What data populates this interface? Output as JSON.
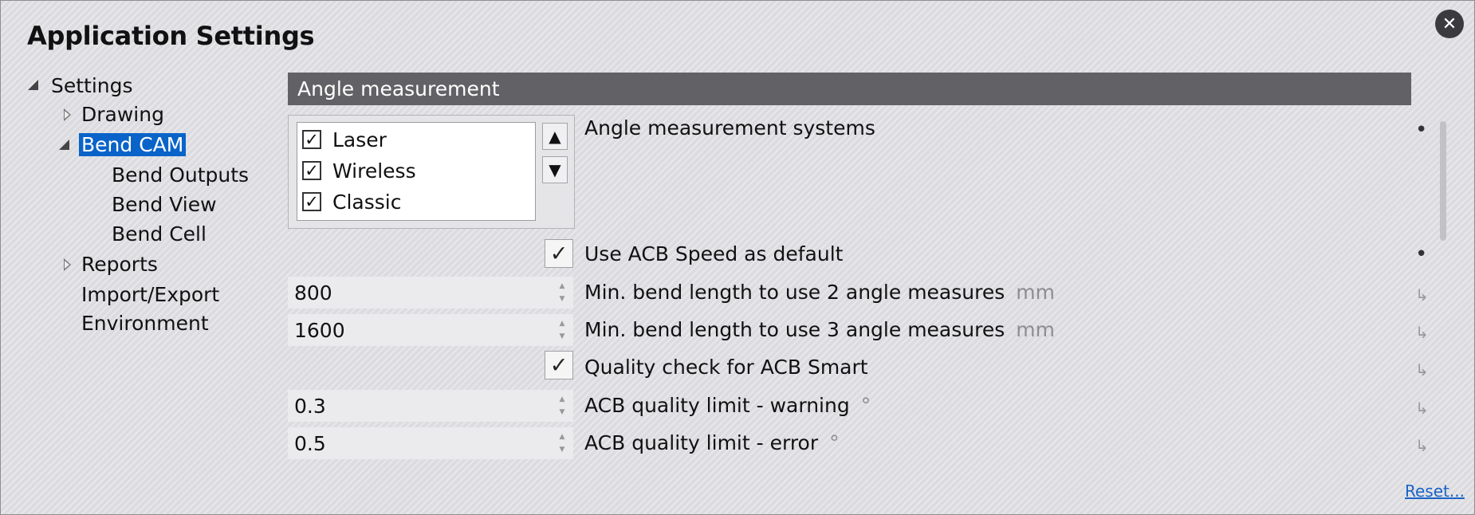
{
  "window": {
    "title": "Application Settings"
  },
  "tree": {
    "root": "Settings",
    "drawing": "Drawing",
    "bend_cam": "Bend CAM",
    "bend_outputs": "Bend Outputs",
    "bend_view": "Bend View",
    "bend_cell": "Bend Cell",
    "reports": "Reports",
    "import_export": "Import/Export",
    "environment": "Environment"
  },
  "section": {
    "header": "Angle measurement"
  },
  "angle_systems": {
    "items": [
      {
        "label": "Laser",
        "checked": true
      },
      {
        "label": "Wireless",
        "checked": true
      },
      {
        "label": "Classic",
        "checked": true
      }
    ],
    "label": "Angle measurement systems"
  },
  "settings": {
    "use_acb_speed": {
      "label": "Use ACB Speed as default",
      "checked": true
    },
    "min_bend_2": {
      "value": "800",
      "label": "Min. bend length to use 2 angle measures",
      "unit": "mm"
    },
    "min_bend_3": {
      "value": "1600",
      "label": "Min. bend length to use 3 angle measures",
      "unit": "mm"
    },
    "quality_check": {
      "label": "Quality check for ACB Smart",
      "checked": true
    },
    "quality_warning": {
      "value": "0.3",
      "label": "ACB quality limit - warning",
      "unit": "°"
    },
    "quality_error": {
      "value": "0.5",
      "label": "ACB quality limit - error",
      "unit": "°"
    }
  },
  "markers": {
    "modified": "•",
    "inherited": "↳"
  },
  "icons": {
    "close": "close-icon",
    "check": "check-icon",
    "arrow_up": "triangle-up-icon",
    "arrow_down": "triangle-down-icon",
    "expander_open": "expander-open-icon",
    "expander_closed": "expander-closed-icon"
  },
  "footer": {
    "reset": "Reset..."
  },
  "colors": {
    "selection": "#0a63c9",
    "section_header": "#626266",
    "link": "#1a63c6"
  }
}
